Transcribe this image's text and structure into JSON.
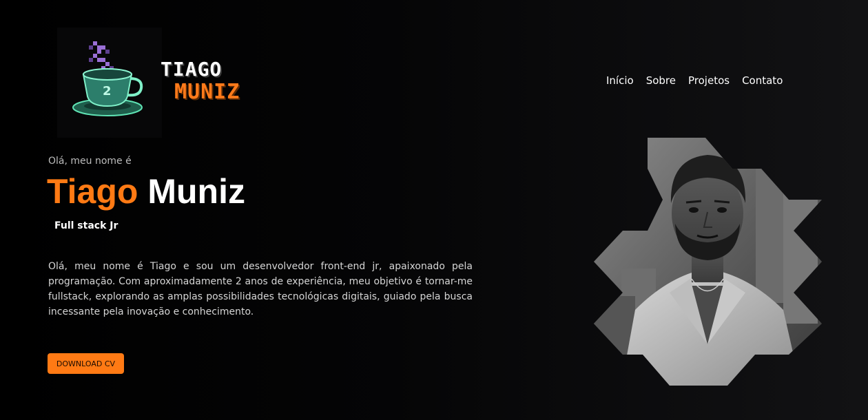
{
  "logo": {
    "first": "TIAGO",
    "last": "MUNIZ",
    "icon": "coffee-cup-icon"
  },
  "nav": {
    "items": [
      "Início",
      "Sobre",
      "Projetos",
      "Contato"
    ]
  },
  "hero": {
    "greeting": "Olá, meu nome é",
    "first_name": "Tiago",
    "last_name": "Muniz",
    "role": "Full stack Jr",
    "bio": "Olá, meu nome é Tiago e sou um desenvolvedor front-end jr, apaixonado pela programação. Com aproximadamente 2 anos de experiência, meu objetivo é tornar-me fullstack, explorando as amplas possibilidades tecnológicas digitais, guiado pela busca incessante pela inovação e conhecimento.",
    "cta_label": "DOWNLOAD CV"
  },
  "colors": {
    "accent": "#ff7a14",
    "background": "#050506",
    "text": "#ffffff"
  }
}
